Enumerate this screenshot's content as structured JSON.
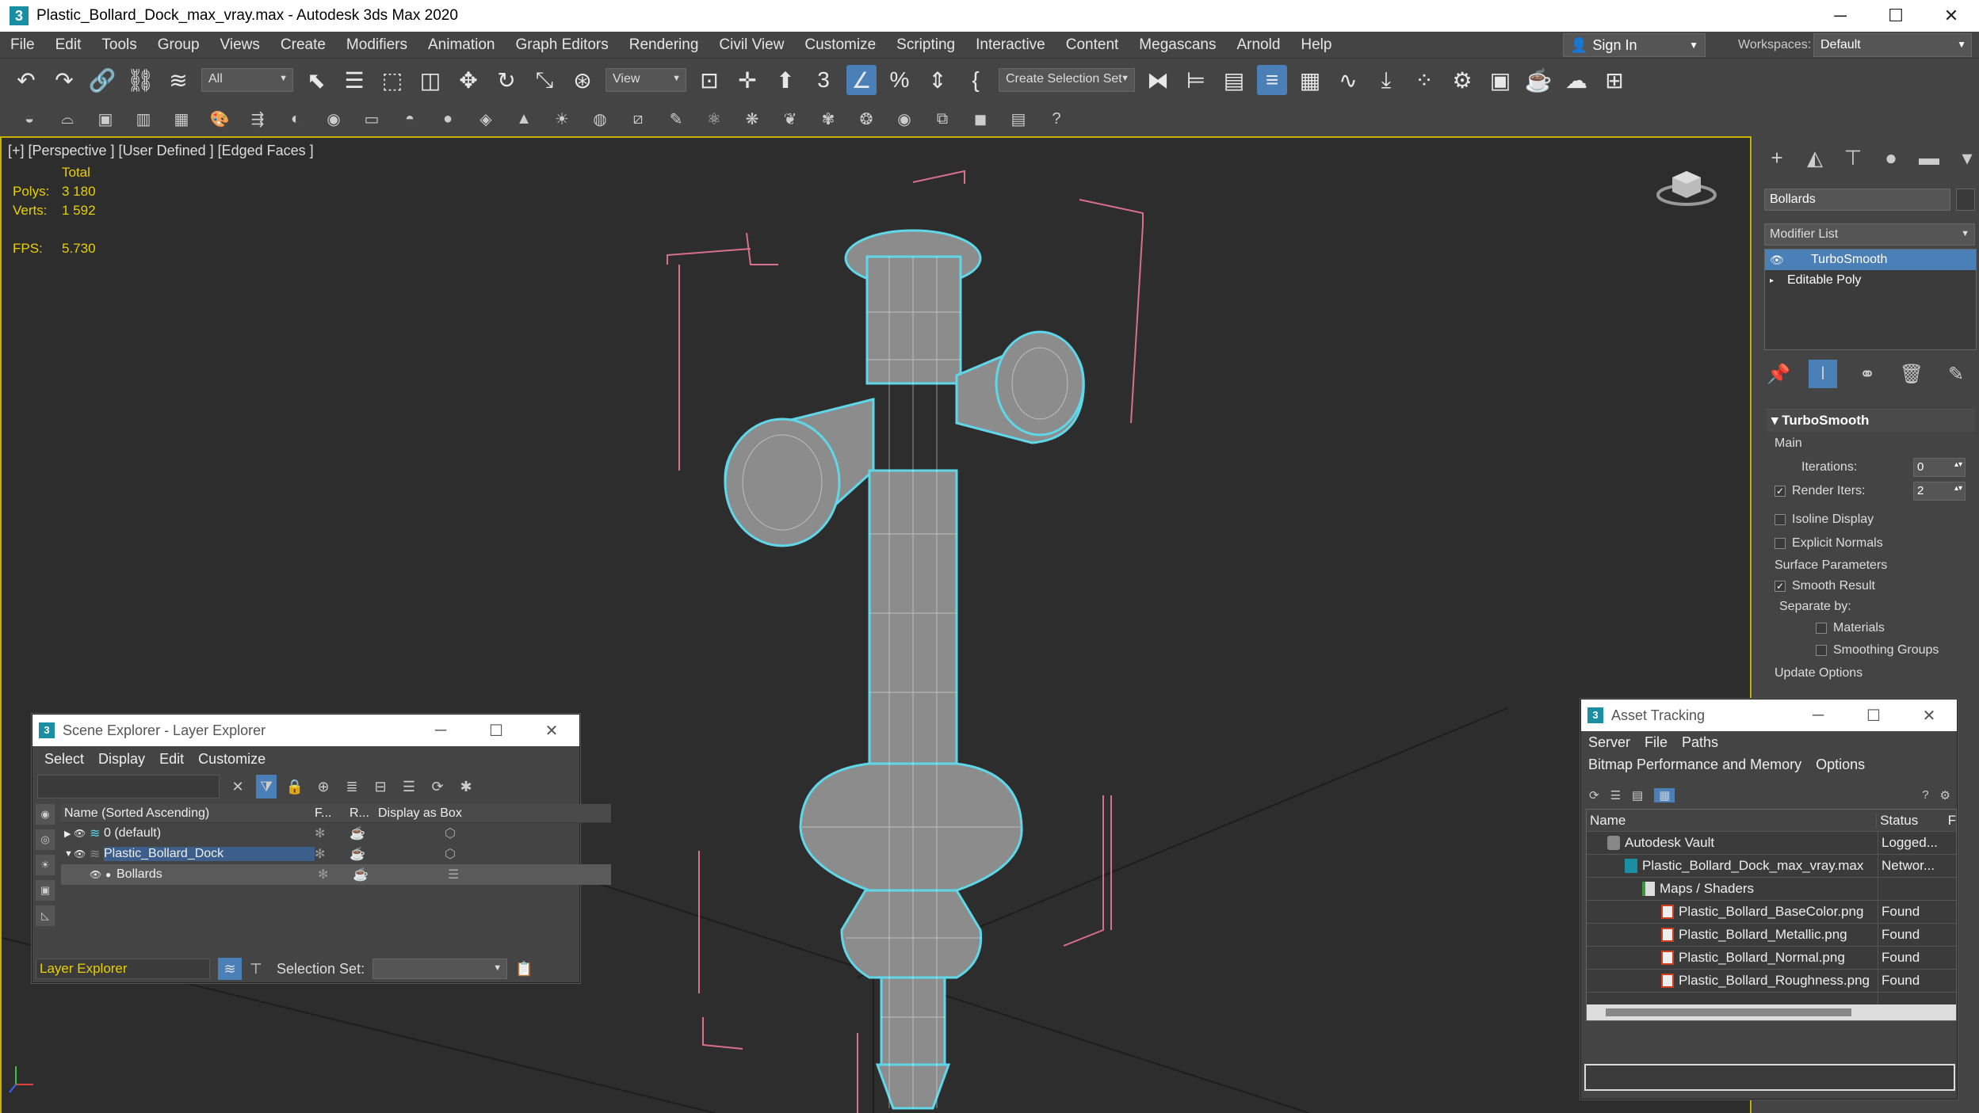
{
  "window": {
    "title": "Plastic_Bollard_Dock_max_vray.max - Autodesk 3ds Max 2020",
    "app_icon": "3"
  },
  "menu": [
    "File",
    "Edit",
    "Tools",
    "Group",
    "Views",
    "Create",
    "Modifiers",
    "Animation",
    "Graph Editors",
    "Rendering",
    "Civil View",
    "Customize",
    "Scripting",
    "Interactive",
    "Content",
    "Megascans",
    "Arnold",
    "Help"
  ],
  "signin": {
    "label": "Sign In"
  },
  "workspaces": {
    "label": "Workspaces:",
    "value": "Default"
  },
  "toolbar": {
    "filter": "All",
    "refcoord": "View",
    "selection_set": "Create Selection Set"
  },
  "viewport": {
    "label": "[+] [Perspective ] [User Defined ] [Edged Faces ]",
    "stats": {
      "total_label": "Total",
      "polys_label": "Polys:",
      "polys": "3 180",
      "verts_label": "Verts:",
      "verts": "1 592",
      "fps_label": "FPS:",
      "fps": "5.730"
    }
  },
  "command_panel": {
    "object_name": "Bollards",
    "modifier_list": "Modifier List",
    "stack": [
      "TurboSmooth",
      "Editable Poly"
    ],
    "rollout": {
      "title": "TurboSmooth",
      "main": "Main",
      "iterations_label": "Iterations:",
      "iterations": "0",
      "render_iters_label": "Render Iters:",
      "render_iters": "2",
      "isoline": "Isoline Display",
      "explicit_normals": "Explicit Normals",
      "surface_params": "Surface Parameters",
      "smooth_result": "Smooth Result",
      "separate_by": "Separate by:",
      "materials": "Materials",
      "smoothing_groups": "Smoothing Groups",
      "update_options": "Update Options"
    }
  },
  "scene_explorer": {
    "title": "Scene Explorer - Layer Explorer",
    "menu": [
      "Select",
      "Display",
      "Edit",
      "Customize"
    ],
    "columns": [
      "Name (Sorted Ascending)",
      "F...",
      "R...",
      "Display as Box"
    ],
    "rows": [
      "0 (default)",
      "Plastic_Bollard_Dock",
      "Bollards"
    ],
    "footer_explorer": "Layer Explorer",
    "selection_set_label": "Selection Set:"
  },
  "asset_tracking": {
    "title": "Asset Tracking",
    "menu1": [
      "Server",
      "File",
      "Paths"
    ],
    "menu2": [
      "Bitmap Performance and Memory",
      "Options"
    ],
    "columns": [
      "Name",
      "Status",
      "F"
    ],
    "rows": [
      {
        "name": "Autodesk Vault",
        "status": "Logged..."
      },
      {
        "name": "Plastic_Bollard_Dock_max_vray.max",
        "status": "Networ..."
      },
      {
        "name": "Maps / Shaders",
        "status": ""
      },
      {
        "name": "Plastic_Bollard_BaseColor.png",
        "status": "Found"
      },
      {
        "name": "Plastic_Bollard_Metallic.png",
        "status": "Found"
      },
      {
        "name": "Plastic_Bollard_Normal.png",
        "status": "Found"
      },
      {
        "name": "Plastic_Bollard_Roughness.png",
        "status": "Found"
      }
    ]
  }
}
